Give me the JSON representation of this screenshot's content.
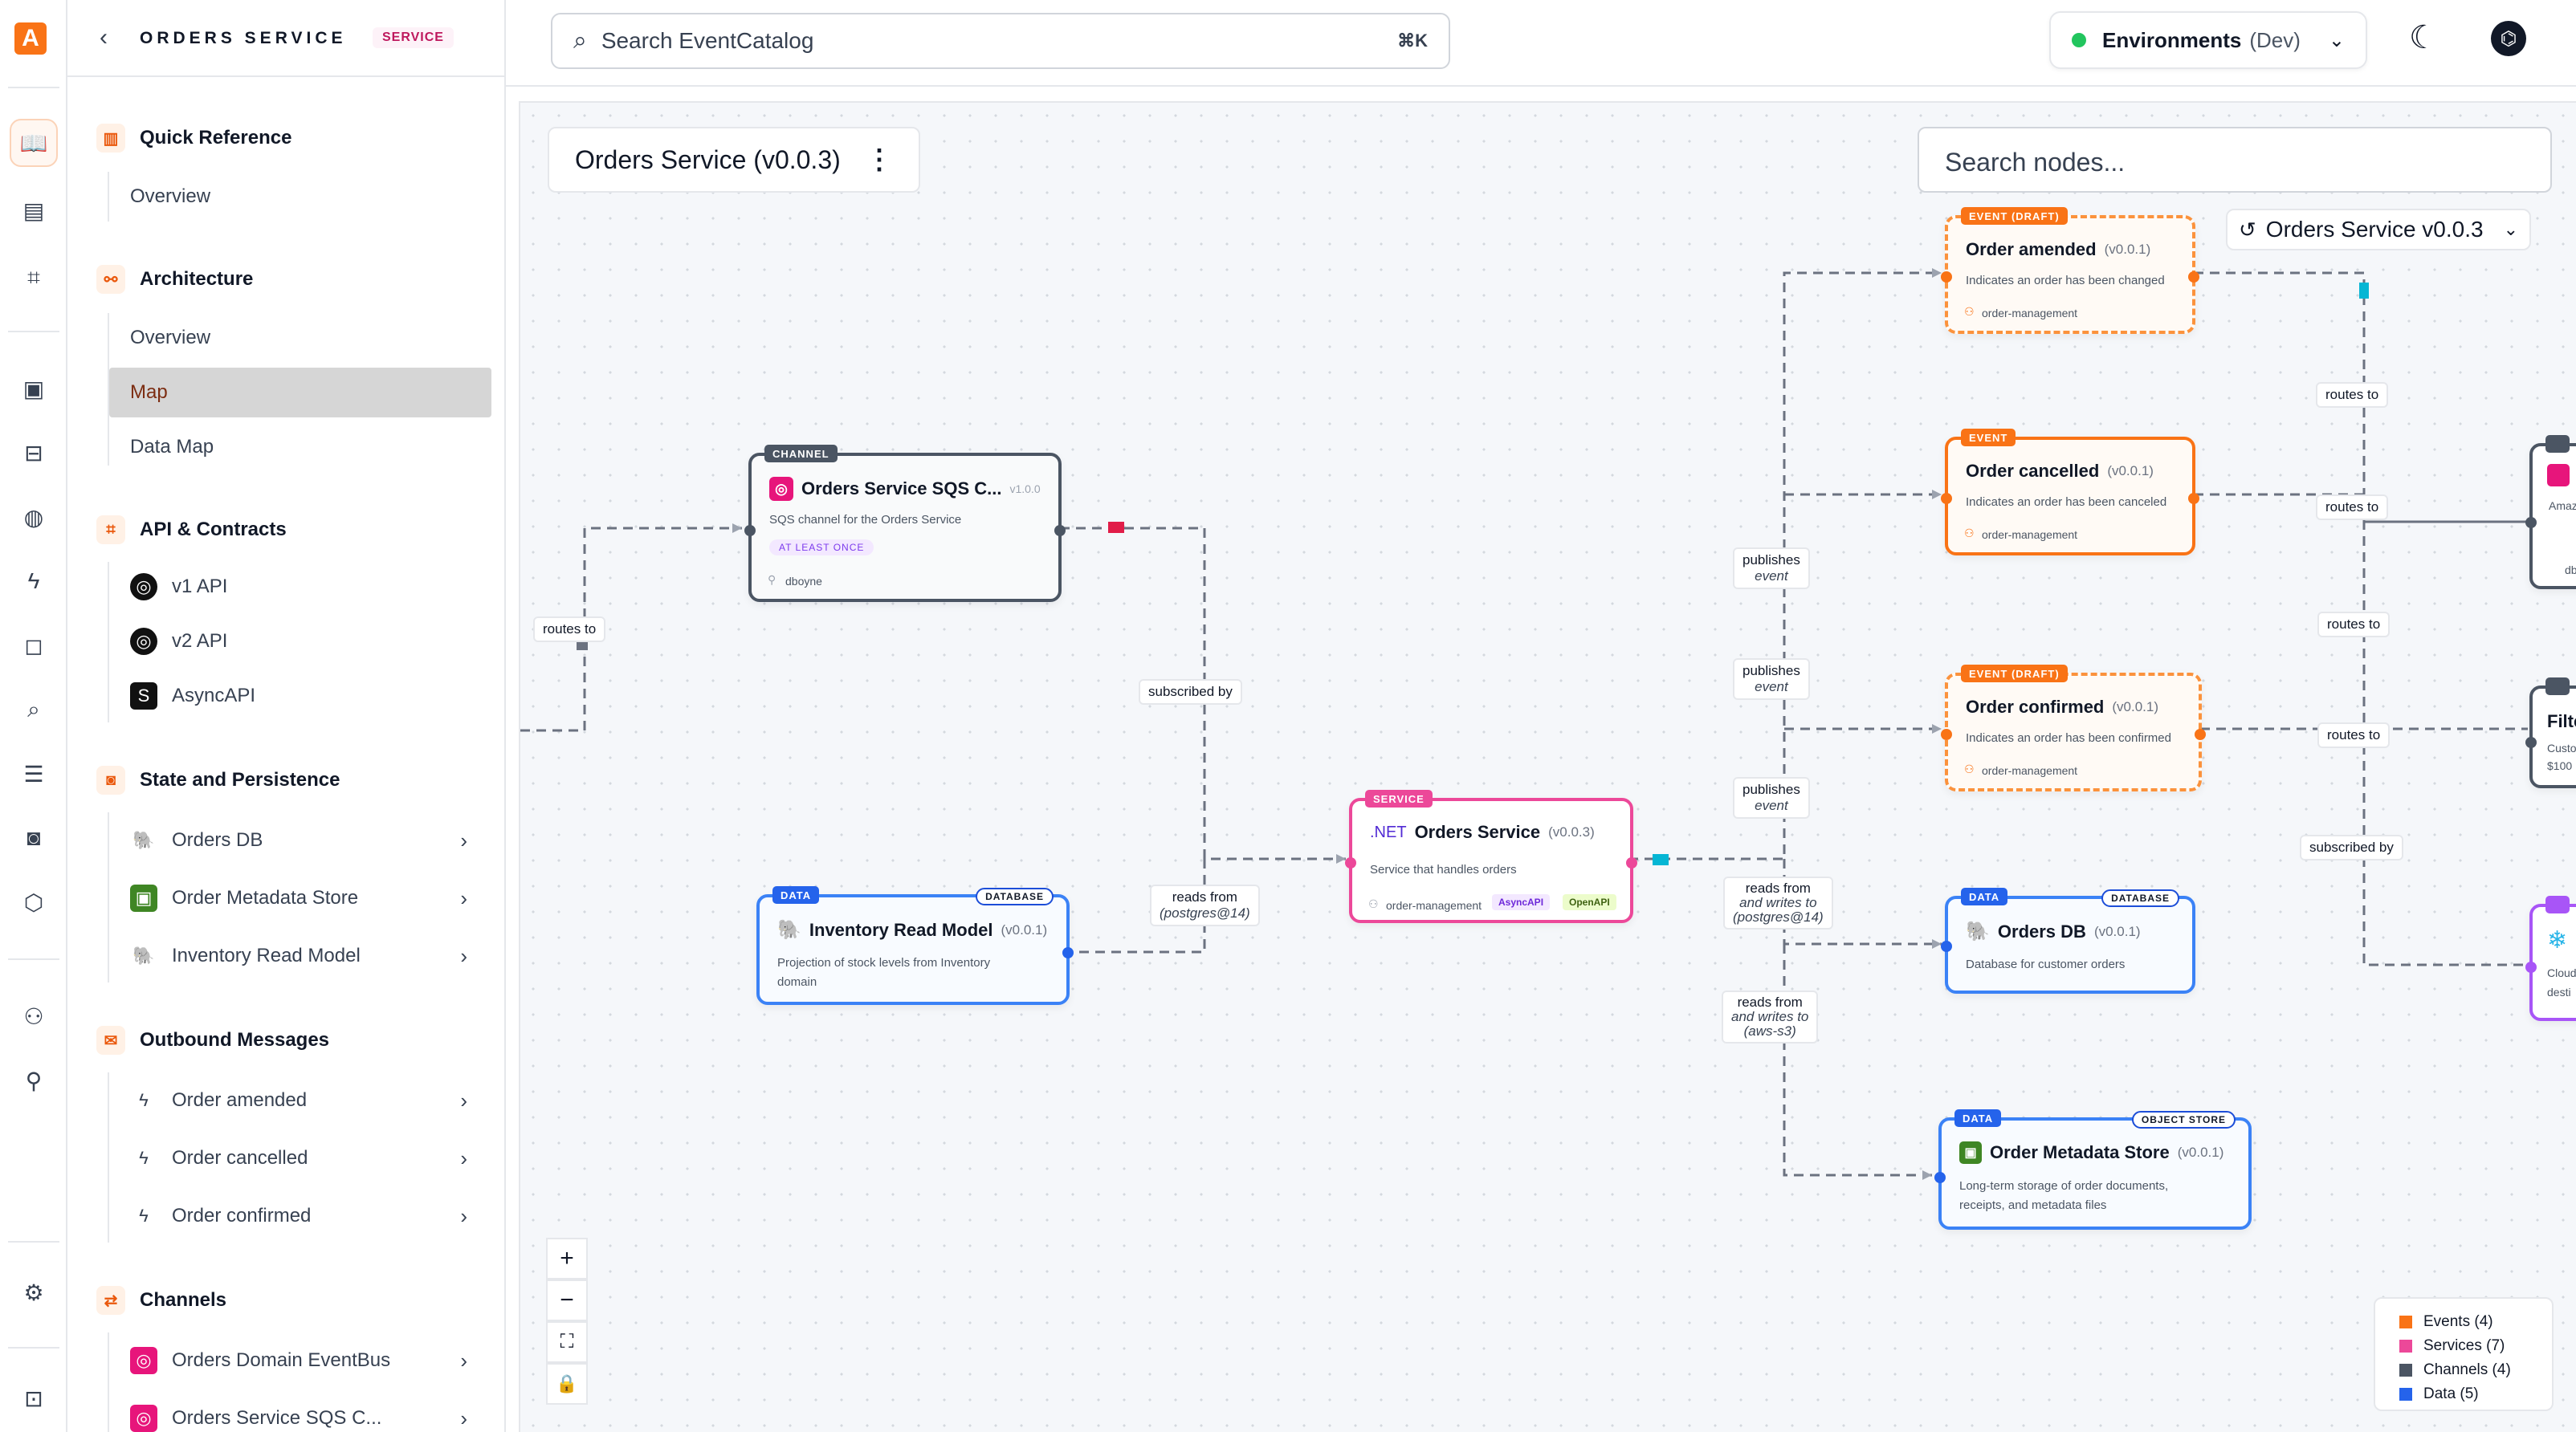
{
  "app": {
    "brand_color": "#f97316",
    "logo_icon": "letter-a-icon"
  },
  "sidebar": {
    "back_title": "ORDERS SERVICE",
    "badge": "SERVICE",
    "sections": {
      "quick_reference": {
        "title": "Quick Reference",
        "items": [
          "Overview"
        ]
      },
      "architecture": {
        "title": "Architecture",
        "items": [
          "Overview",
          "Map",
          "Data Map"
        ],
        "active": "Map"
      },
      "api": {
        "title": "API & Contracts",
        "items": [
          "v1 API",
          "v2 API",
          "AsyncAPI"
        ]
      },
      "state": {
        "title": "State and Persistence",
        "items": [
          "Orders DB",
          "Order Metadata Store",
          "Inventory Read Model"
        ]
      },
      "outbound": {
        "title": "Outbound Messages",
        "items": [
          "Order amended",
          "Order cancelled",
          "Order confirmed"
        ]
      },
      "channels": {
        "title": "Channels",
        "items": [
          "Orders Domain EventBus",
          "Orders Service SQS C..."
        ]
      }
    }
  },
  "topbar": {
    "search_placeholder": "Search EventCatalog",
    "search_shortcut": "⌘K",
    "env_label": "Environments",
    "env_value": "(Dev)",
    "env_status_color": "#22c55e"
  },
  "canvas": {
    "title": "Orders Service (v0.0.3)",
    "search_nodes_placeholder": "Search nodes...",
    "version_select": "Orders Service v0.0.3",
    "nodes": {
      "sqs": {
        "tag": "CHANNEL",
        "title": "Orders Service SQS C...",
        "version": "v1.0.0",
        "desc": "SQS channel for the Orders Service",
        "pill": "AT LEAST ONCE",
        "owner": "dboyne"
      },
      "orders_service": {
        "tag": "SERVICE",
        "prefix": ".NET",
        "title": "Orders Service",
        "version": "(v0.0.3)",
        "desc": "Service that handles orders",
        "owner": "order-management",
        "badge1": "AsyncAPI",
        "badge2": "OpenAPI"
      },
      "inventory": {
        "tag": "DATA",
        "rtag": "DATABASE",
        "title": "Inventory Read Model",
        "version": "(v0.0.1)",
        "desc1": "Projection of stock levels from Inventory",
        "desc2": "domain"
      },
      "amended": {
        "tag": "EVENT (DRAFT)",
        "title": "Order amended",
        "version": "(v0.0.1)",
        "desc": "Indicates an order has been changed",
        "owner": "order-management"
      },
      "cancelled": {
        "tag": "EVENT",
        "title": "Order cancelled",
        "version": "(v0.0.1)",
        "desc": "Indicates an order has been canceled",
        "owner": "order-management"
      },
      "confirmed": {
        "tag": "EVENT (DRAFT)",
        "title": "Order confirmed",
        "version": "(v0.0.1)",
        "desc": "Indicates an order has been confirmed",
        "owner": "order-management"
      },
      "orders_db": {
        "tag": "DATA",
        "rtag": "DATABASE",
        "title": "Orders DB",
        "version": "(v0.0.1)",
        "desc": "Database for customer orders"
      },
      "metadata": {
        "tag": "DATA",
        "rtag": "OBJECT STORE",
        "title": "Order Metadata Store",
        "version": "(v0.0.1)",
        "desc1": "Long-term storage of order documents,",
        "desc2": "receipts, and metadata files"
      },
      "partial_amazon": {
        "text": "Amaz",
        "owner": "db"
      },
      "partial_filter": {
        "title": "Filte",
        "desc1": "Custo",
        "desc2": "$100"
      },
      "partial_cloud": {
        "desc1": "Cloud",
        "desc2": "desti"
      }
    },
    "edge_labels": {
      "routes_to": "routes to",
      "subscribed_by": "subscribed by",
      "reads_from": "reads from",
      "pg14": "(postgres@14)",
      "publishes": "publishes",
      "event": "event",
      "and_writes_to": "and writes to",
      "aws_s3": "(aws-s3)"
    },
    "legend": [
      {
        "label": "Events (4)",
        "color": "#f97316"
      },
      {
        "label": "Services (7)",
        "color": "#ec4899"
      },
      {
        "label": "Channels (4)",
        "color": "#4b5563"
      },
      {
        "label": "Data (5)",
        "color": "#2563eb"
      }
    ],
    "controls": {
      "zoom_in": "+",
      "zoom_out": "−",
      "fit": "⛶",
      "lock": "🔒"
    }
  }
}
